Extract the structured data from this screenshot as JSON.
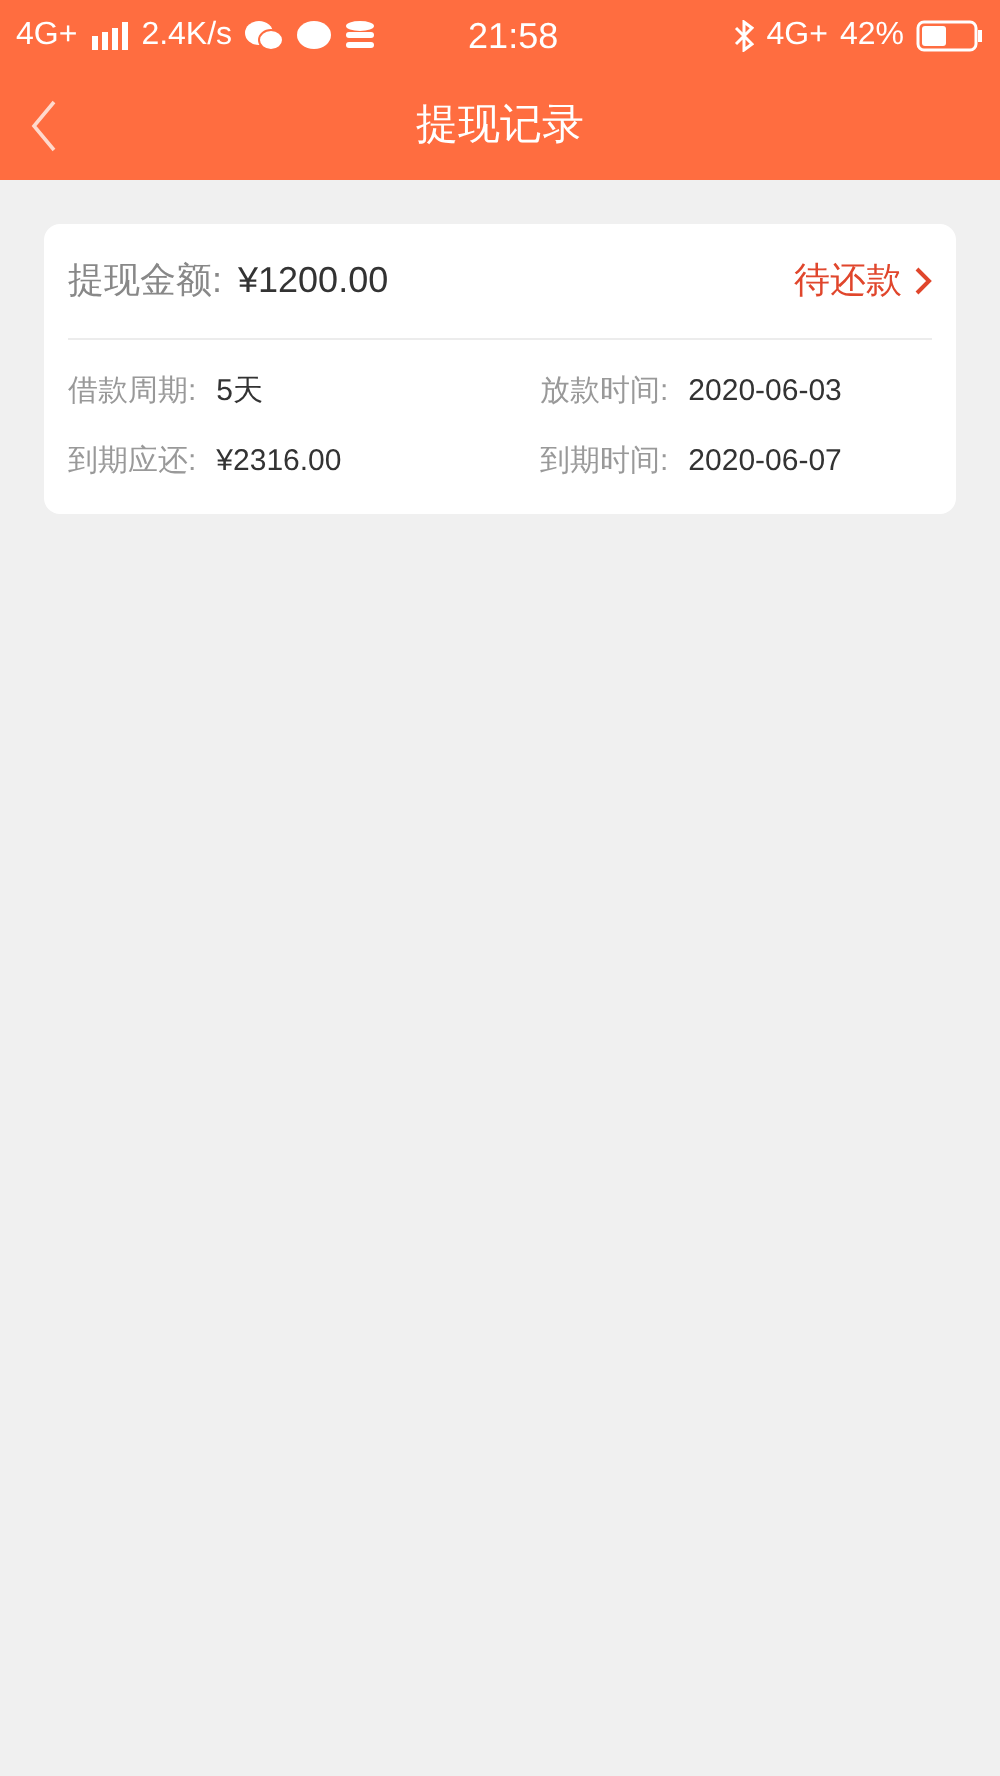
{
  "status_bar": {
    "network": "4G+",
    "speed": "2.4K/s",
    "time": "21:58",
    "network_right": "4G+",
    "battery": "42%"
  },
  "header": {
    "title": "提现记录"
  },
  "record": {
    "amount_label": "提现金额:",
    "amount": "¥1200.00",
    "status": "待还款",
    "details": [
      {
        "label": "借款周期:",
        "value": "5天"
      },
      {
        "label": "放款时间:",
        "value": "2020-06-03"
      },
      {
        "label": "到期应还:",
        "value": "¥2316.00"
      },
      {
        "label": "到期时间:",
        "value": "2020-06-07"
      }
    ]
  }
}
